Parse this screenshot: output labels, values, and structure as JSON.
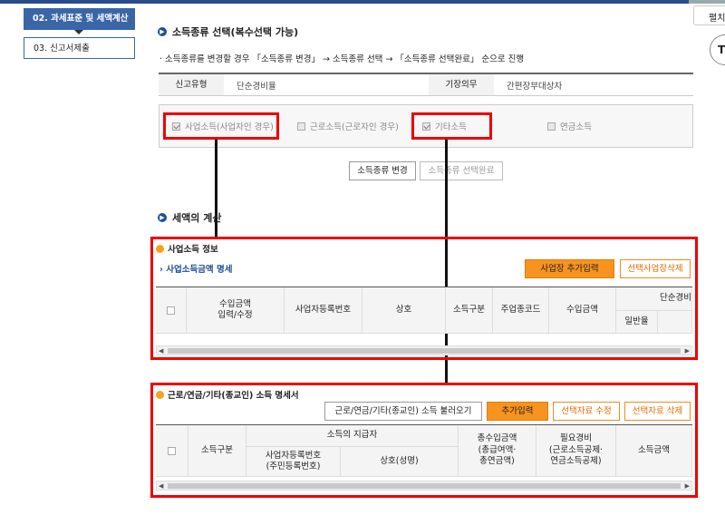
{
  "nav": {
    "step2": "02. 과세표준 및 세액계산",
    "step3": "03. 신고서제출"
  },
  "edge": {
    "tab": "펼치",
    "circle": "T"
  },
  "section1": {
    "title": "소득종류 선택(복수선택 가능)",
    "note": "· 소득종류를 변경할 경우 「소득종류 변경」 → 소득종류 선택 → 「소득종류 선택완료」 순으로 진행",
    "info": {
      "filing_type_label": "신고유형",
      "filing_type_value": "단순경비율",
      "bookkeeping_label": "기장의무",
      "bookkeeping_value": "간편장부대상자"
    },
    "income_types": [
      {
        "label": "사업소득(사업자인 경우)",
        "checked": true
      },
      {
        "label": "근로소득(근로자인 경우)",
        "checked": false
      },
      {
        "label": "기타소득",
        "checked": true
      },
      {
        "label": "연금소득",
        "checked": false
      }
    ],
    "change_button": "소득종류 변경",
    "complete_button": "소득종류 선택완료"
  },
  "section2": {
    "title": "세액의 계산"
  },
  "business": {
    "title": "사업소득 정보",
    "link": "사업소득금액 명세",
    "add_button": "사업장 추가입력",
    "delete_button": "선택사업장삭제",
    "headers": {
      "revenue_input": "수입금액\n입력/수정",
      "biz_reg_no": "사업자등록번호",
      "trade_name": "상호",
      "income_type": "소득구분",
      "industry_code": "주업종코드",
      "revenue": "수입금액",
      "simple_expense": "단순경비",
      "general_rate": "일반율"
    }
  },
  "other": {
    "title": "근로/연금/기타(종교인) 소득 명세서",
    "load_button": "근로/연금/기타(종교인) 소득 불러오기",
    "add_button": "추가입력",
    "edit_button": "선택자료 수정",
    "delete_button": "선택자료 삭제",
    "headers": {
      "income_type": "소득구분",
      "payer": "소득의 지급자",
      "biz_reg_no": "사업자등록번호\n(주민등록번호)",
      "trade_name": "상호(성명)",
      "gross_income": "총수입금액\n(총급여액·\n총연금액)",
      "necessary_expense": "필요경비\n(근로소득공제·\n연금소득공제)",
      "income_amount": "소득금액"
    }
  },
  "colors": {
    "accent": "#3a66a8",
    "highlight": "#e00000",
    "orange": "#f7931e"
  }
}
